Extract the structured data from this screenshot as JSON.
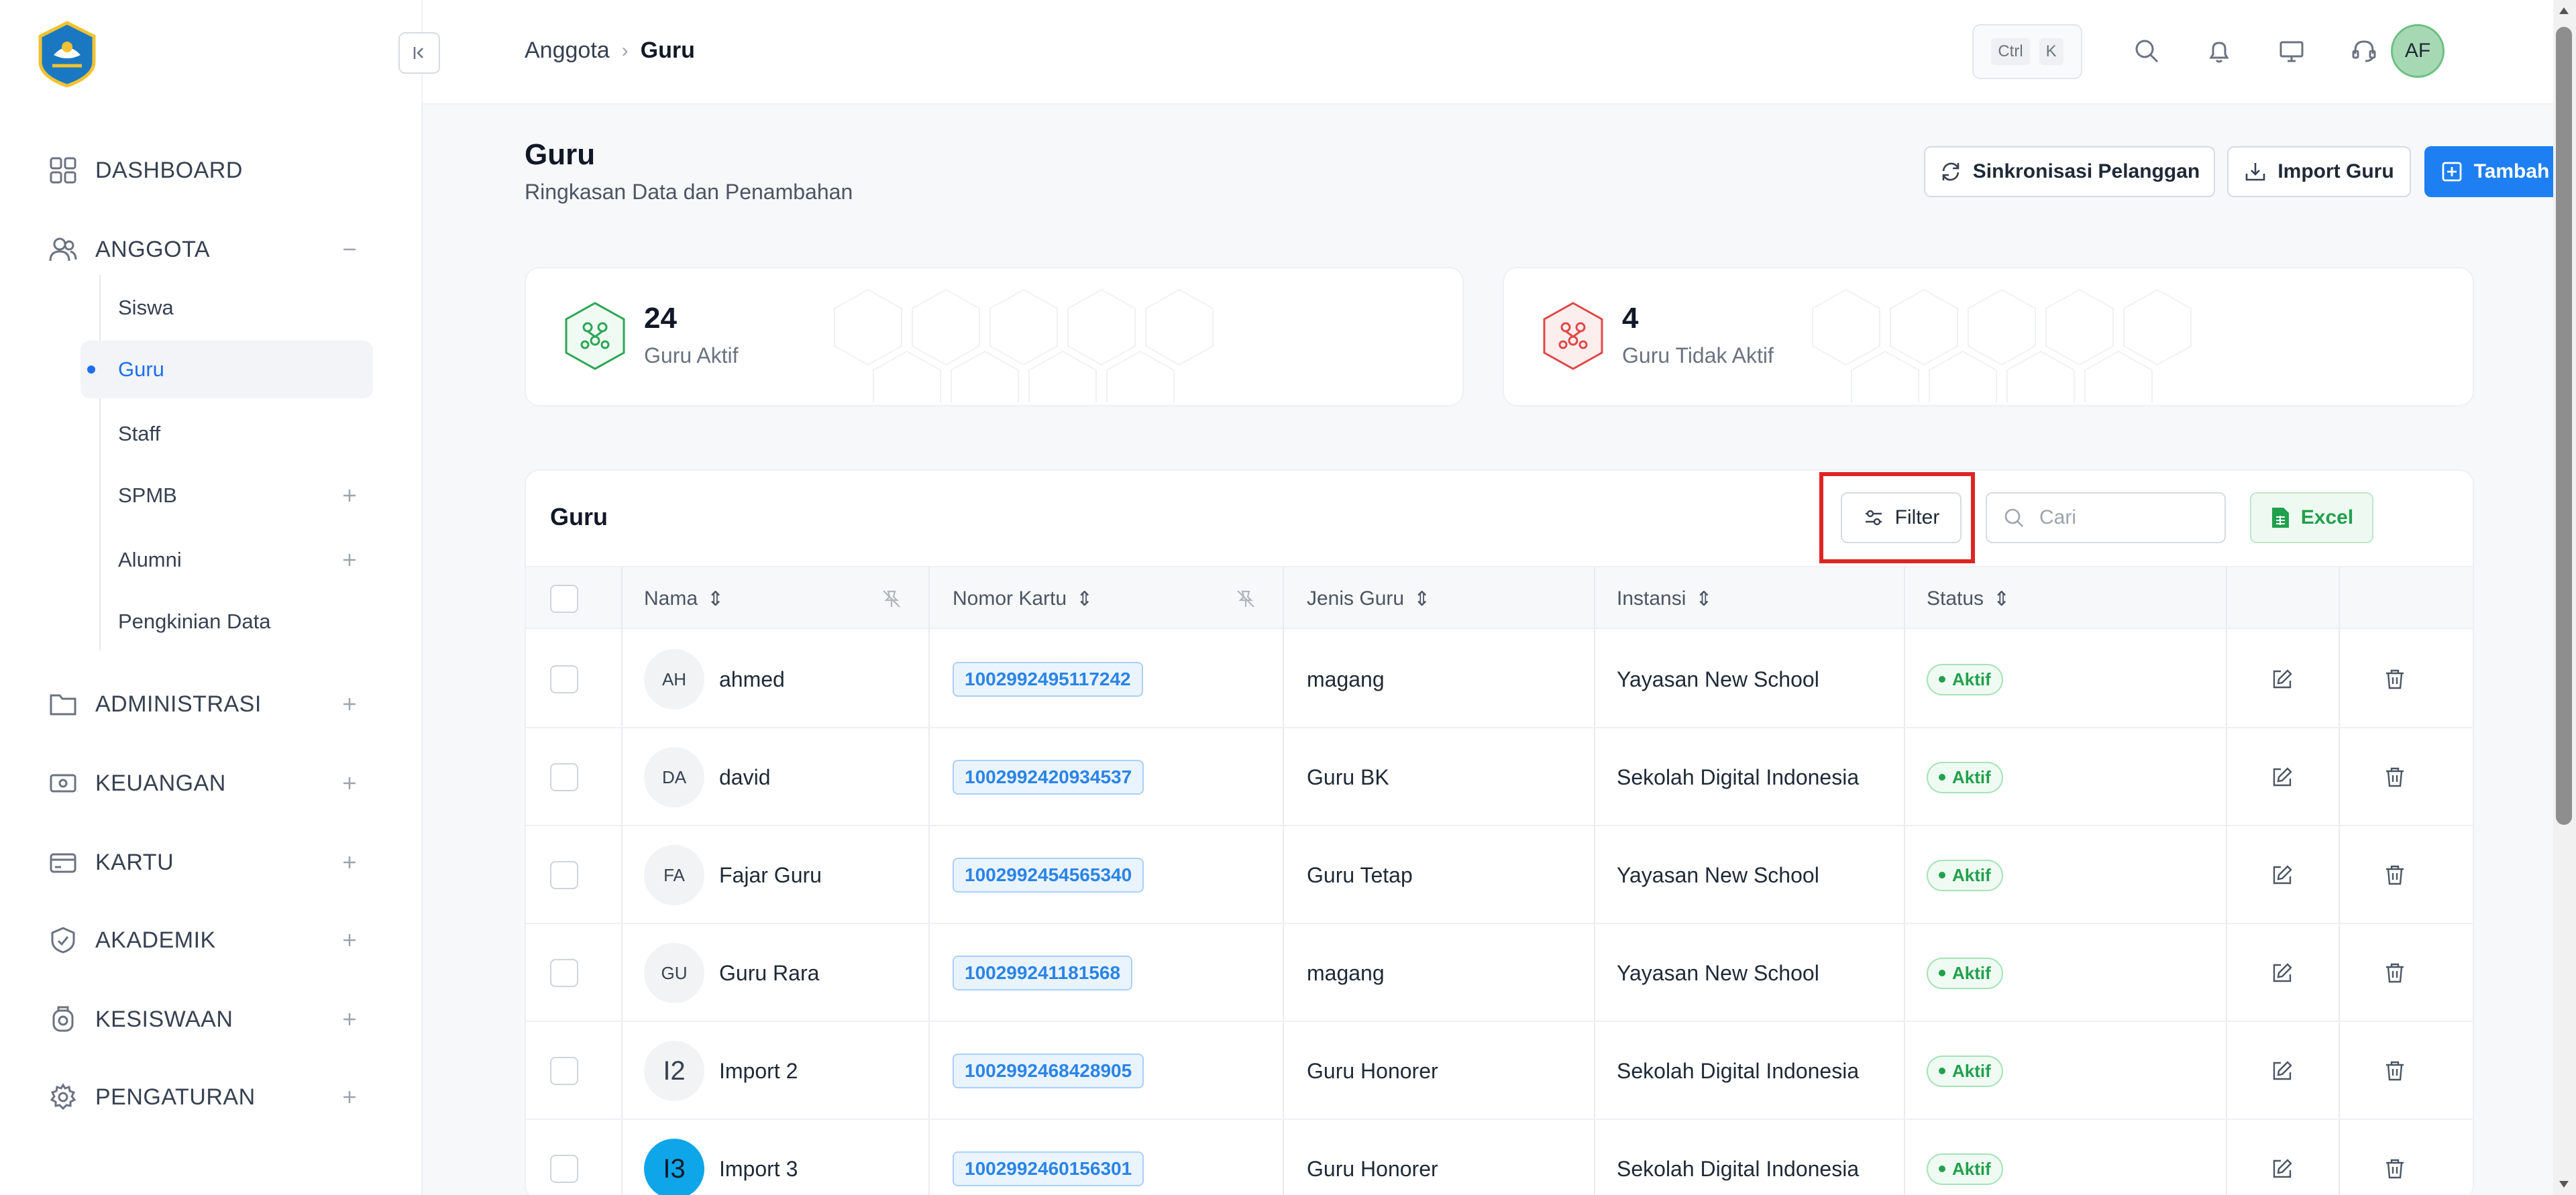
{
  "breadcrumb": {
    "parent": "Anggota",
    "current": "Guru"
  },
  "topbar": {
    "kbd_ctrl": "Ctrl",
    "kbd_k": "K",
    "avatar": "AF"
  },
  "sidebar": {
    "items": [
      {
        "label": "DASHBOARD",
        "icon": "grid-icon"
      },
      {
        "label": "ANGGOTA",
        "icon": "users-icon"
      },
      {
        "label": "ADMINISTRASI",
        "icon": "folder-icon"
      },
      {
        "label": "KEUANGAN",
        "icon": "money-icon"
      },
      {
        "label": "KARTU",
        "icon": "card-icon"
      },
      {
        "label": "AKADEMIK",
        "icon": "academic-icon"
      },
      {
        "label": "KESISWAAN",
        "icon": "student-icon"
      },
      {
        "label": "PENGATURAN",
        "icon": "gear-icon"
      }
    ],
    "sub_items": [
      {
        "label": "Siswa"
      },
      {
        "label": "Guru"
      },
      {
        "label": "Staff"
      },
      {
        "label": "SPMB"
      },
      {
        "label": "Alumni"
      },
      {
        "label": "Pengkinian Data"
      }
    ]
  },
  "page": {
    "title": "Guru",
    "subtitle": "Ringkasan Data dan Penambahan",
    "btn_sync": "Sinkronisasi Pelanggan",
    "btn_import": "Import Guru",
    "btn_add": "Tambah Guru"
  },
  "stats": {
    "active_count": "24",
    "active_label": "Guru Aktif",
    "inactive_count": "4",
    "inactive_label": "Guru Tidak Aktif"
  },
  "table": {
    "title": "Guru",
    "filter_label": "Filter",
    "search_placeholder": "Cari",
    "excel_label": "Excel",
    "headers": {
      "nama": "Nama",
      "nomor_kartu": "Nomor Kartu",
      "jenis_guru": "Jenis Guru",
      "instansi": "Instansi",
      "status": "Status"
    },
    "rows": [
      {
        "initials": "AH",
        "nama": "ahmed",
        "kartu": "1002992495117242",
        "jenis": "magang",
        "instansi": "Yayasan New School",
        "status": "Aktif"
      },
      {
        "initials": "DA",
        "nama": "david",
        "kartu": "1002992420934537",
        "jenis": "Guru BK",
        "instansi": "Sekolah Digital Indonesia",
        "status": "Aktif"
      },
      {
        "initials": "FA",
        "nama": "Fajar Guru",
        "kartu": "1002992454565340",
        "jenis": "Guru Tetap",
        "instansi": "Yayasan New School",
        "status": "Aktif"
      },
      {
        "initials": "GU",
        "nama": "Guru Rara",
        "kartu": "100299241181568",
        "jenis": "magang",
        "instansi": "Yayasan New School",
        "status": "Aktif"
      },
      {
        "initials": "I2",
        "nama": "Import 2",
        "kartu": "1002992468428905",
        "jenis": "Guru Honorer",
        "instansi": "Sekolah Digital Indonesia",
        "status": "Aktif"
      },
      {
        "initials": "I3",
        "nama": "Import 3",
        "kartu": "1002992460156301",
        "jenis": "Guru Honorer",
        "instansi": "Sekolah Digital Indonesia",
        "status": "Aktif"
      }
    ]
  },
  "colors": {
    "primary": "#1d7ff2",
    "success": "#22a04d",
    "danger": "#e02424"
  }
}
